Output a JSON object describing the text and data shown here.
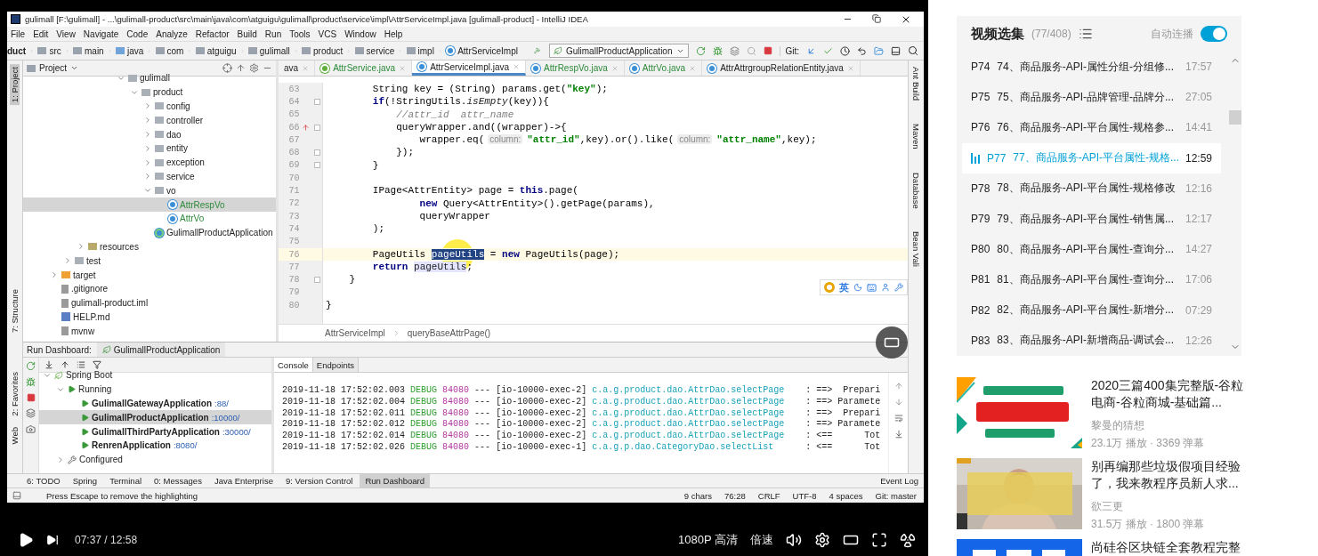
{
  "ide": {
    "window_title": "gulimall [F:\\gulimall] - ...\\gulimall-product\\src\\main\\java\\com\\atguigu\\gulimall\\product\\service\\impl\\AttrServiceImpl.java [gulimall-product] - IntelliJ IDEA",
    "menu": [
      "File",
      "Edit",
      "View",
      "Navigate",
      "Code",
      "Analyze",
      "Refactor",
      "Build",
      "Run",
      "Tools",
      "VCS",
      "Window",
      "Help"
    ],
    "breadcrumbs": [
      {
        "label": "duct",
        "kind": "module"
      },
      {
        "label": "src",
        "kind": "folder"
      },
      {
        "label": "main",
        "kind": "folder"
      },
      {
        "label": "java",
        "kind": "source"
      },
      {
        "label": "com",
        "kind": "folder"
      },
      {
        "label": "atguigu",
        "kind": "folder"
      },
      {
        "label": "gulimall",
        "kind": "folder"
      },
      {
        "label": "product",
        "kind": "folder"
      },
      {
        "label": "service",
        "kind": "folder"
      },
      {
        "label": "impl",
        "kind": "folder"
      },
      {
        "label": "AttrServiceImpl",
        "kind": "class"
      }
    ],
    "run_config": "GulimallProductApplication",
    "vcs_label": "Git:",
    "left_stripe": [
      {
        "label": "1: Project",
        "selected": true
      },
      {
        "label": "7: Structure",
        "selected": false
      },
      {
        "label": "2: Favorites",
        "selected": false
      },
      {
        "label": "Web",
        "selected": false
      }
    ],
    "project": {
      "title": "Project",
      "tree": [
        {
          "children": [
            {
              "children": [
                {
                  "children": [
                    {
                      "children": [
                        {
                          "children": [
                            {
                              "label": "gulimall",
                              "kind": "folder",
                              "expanded": true,
                              "selected": false,
                              "children": [
                                {
                                  "label": "product",
                                  "kind": "folder",
                                  "expanded": true,
                                  "selected": false,
                                  "children": [
                                    {
                                      "label": "config",
                                      "kind": "folder",
                                      "expanded": false,
                                      "selected": false
                                    },
                                    {
                                      "label": "controller",
                                      "kind": "folder",
                                      "expanded": false,
                                      "selected": false
                                    },
                                    {
                                      "label": "dao",
                                      "kind": "folder",
                                      "expanded": false,
                                      "selected": false
                                    },
                                    {
                                      "label": "entity",
                                      "kind": "folder",
                                      "expanded": false,
                                      "selected": false
                                    },
                                    {
                                      "label": "exception",
                                      "kind": "folder",
                                      "expanded": false,
                                      "selected": false
                                    },
                                    {
                                      "label": "service",
                                      "kind": "folder",
                                      "expanded": false,
                                      "selected": false
                                    },
                                    {
                                      "label": "vo",
                                      "kind": "folder",
                                      "expanded": true,
                                      "selected": false,
                                      "children": [
                                        {
                                          "label": "AttrRespVo",
                                          "kind": "added_class",
                                          "selected": true
                                        },
                                        {
                                          "label": "AttrVo",
                                          "kind": "added_class",
                                          "selected": false
                                        }
                                      ]
                                    },
                                    {
                                      "label": "GulimallProductApplication",
                                      "kind": "app",
                                      "selected": false
                                    }
                                  ]
                                }
                              ]
                            }
                          ]
                        }
                      ]
                    }
                  ]
                },
                {
                  "label": "resources",
                  "kind": "resources",
                  "expanded": false,
                  "selected": false
                }
              ]
            },
            {
              "label": "test",
              "kind": "folder",
              "expanded": false,
              "selected": false
            }
          ]
        },
        {
          "label": "target",
          "kind": "excluded",
          "expanded": false,
          "selected": false
        },
        {
          "label": ".gitignore",
          "kind": "file",
          "selected": false
        },
        {
          "label": "gulimall-product.iml",
          "kind": "file",
          "selected": false
        },
        {
          "label": "HELP.md",
          "kind": "markdown",
          "selected": false
        },
        {
          "label": "mvnw",
          "kind": "file",
          "selected": false
        }
      ]
    },
    "editor_tabs": [
      {
        "label": "ava",
        "kind": "partial",
        "added": false,
        "selected": false
      },
      {
        "label": "AttrService.java",
        "kind": "interface",
        "added": true,
        "selected": false
      },
      {
        "label": "AttrServiceImpl.java",
        "kind": "class",
        "added": false,
        "selected": true
      },
      {
        "label": "AttrRespVo.java",
        "kind": "class",
        "added": true,
        "selected": false
      },
      {
        "label": "AttrVo.java",
        "kind": "class",
        "added": true,
        "selected": false
      },
      {
        "label": "AttrAttrgroupRelationEntity.java",
        "kind": "class",
        "added": false,
        "selected": false
      }
    ],
    "code": [
      {
        "number": "63",
        "current": false,
        "fold": false,
        "override": false,
        "tokens": [
          {
            "kind": "plain",
            "text": "        String key = (String) params.get("
          },
          {
            "kind": "string",
            "text": "\"key\""
          },
          {
            "kind": "plain",
            "text": ");"
          }
        ]
      },
      {
        "number": "64",
        "current": false,
        "fold": true,
        "override": false,
        "tokens": [
          {
            "kind": "keyword",
            "text": "        if"
          },
          {
            "kind": "plain",
            "text": "(!StringUtils."
          },
          {
            "kind": "static",
            "text": "isEmpty"
          },
          {
            "kind": "plain",
            "text": "(key)){"
          }
        ]
      },
      {
        "number": "65",
        "current": false,
        "fold": false,
        "override": false,
        "tokens": [
          {
            "kind": "comment",
            "text": "            //attr_id  attr_name"
          }
        ]
      },
      {
        "number": "66",
        "current": false,
        "fold": true,
        "override": true,
        "tokens": [
          {
            "kind": "plain",
            "text": "            queryWrapper.and((wrapper)->{"
          }
        ]
      },
      {
        "number": "67",
        "current": false,
        "fold": false,
        "override": false,
        "tokens": [
          {
            "kind": "plain",
            "text": "                wrapper.eq("
          },
          {
            "kind": "hint",
            "text": "column:"
          },
          {
            "kind": "string",
            "text": "\"attr_id\""
          },
          {
            "kind": "plain",
            "text": ",key).or().like("
          },
          {
            "kind": "hint",
            "text": "column:"
          },
          {
            "kind": "string",
            "text": "\"attr_name\""
          },
          {
            "kind": "plain",
            "text": ",key);"
          }
        ]
      },
      {
        "number": "68",
        "current": false,
        "fold": true,
        "override": false,
        "tokens": [
          {
            "kind": "plain",
            "text": "            });"
          }
        ]
      },
      {
        "number": "69",
        "current": false,
        "fold": true,
        "override": false,
        "tokens": [
          {
            "kind": "plain",
            "text": "        }"
          }
        ]
      },
      {
        "number": "70",
        "current": false,
        "fold": false,
        "override": false
      },
      {
        "number": "71",
        "current": false,
        "fold": false,
        "override": false,
        "tokens": [
          {
            "kind": "plain",
            "text": "        IPage<AttrEntity> page = "
          },
          {
            "kind": "keyword",
            "text": "this"
          },
          {
            "kind": "plain",
            "text": ".page("
          }
        ]
      },
      {
        "number": "72",
        "current": false,
        "fold": false,
        "override": false,
        "tokens": [
          {
            "kind": "keyword",
            "text": "                new"
          },
          {
            "kind": "plain",
            "text": " Query<AttrEntity>().getPage(params),"
          }
        ]
      },
      {
        "number": "73",
        "current": false,
        "fold": false,
        "override": false,
        "tokens": [
          {
            "kind": "plain",
            "text": "                queryWrapper"
          }
        ]
      },
      {
        "number": "74",
        "current": false,
        "fold": false,
        "override": false,
        "tokens": [
          {
            "kind": "plain",
            "text": "        );"
          }
        ]
      },
      {
        "number": "75",
        "current": false,
        "fold": false,
        "override": false
      },
      {
        "number": "76",
        "current": true,
        "fold": false,
        "override": false,
        "tokens": [
          {
            "kind": "plain",
            "text": "        PageUtils "
          },
          {
            "kind": "selected",
            "text": "pageUtils"
          },
          {
            "kind": "plain",
            "text": " = "
          },
          {
            "kind": "keyword",
            "text": "new"
          },
          {
            "kind": "plain",
            "text": " PageUtils(page);"
          }
        ]
      },
      {
        "number": "77",
        "current": false,
        "fold": false,
        "override": false,
        "tokens": [
          {
            "kind": "keyword",
            "text": "        return "
          },
          {
            "kind": "usage",
            "text": "pageUtils"
          },
          {
            "kind": "plain",
            "text": ";"
          }
        ]
      },
      {
        "number": "78",
        "current": false,
        "fold": true,
        "override": false,
        "tokens": [
          {
            "kind": "plain",
            "text": "    }"
          }
        ]
      },
      {
        "number": "79",
        "current": false,
        "fold": false,
        "override": false
      },
      {
        "number": "80",
        "current": false,
        "fold": false,
        "override": false,
        "tokens": [
          {
            "kind": "plain",
            "text": "}"
          }
        ]
      }
    ],
    "editor_breadcrumbs": [
      "AttrServiceImpl",
      "queryBaseAttrPage()"
    ],
    "right_stripe": [
      "Ant Build",
      "Maven",
      "Database",
      "Bean Vali"
    ],
    "ime_toolbar": {
      "label": "英"
    },
    "run_dashboard": {
      "title": "Run Dashboard:",
      "tab": "GulimallProductApplication",
      "tree": [
        {
          "label": "Spring Boot",
          "kind": "group",
          "expanded": true,
          "selected": false,
          "children": [
            {
              "label": "Running",
              "kind": "status",
              "expanded": true,
              "selected": false,
              "children": [
                {
                  "label": "GulimallGatewayApplication",
                  "port": ":88/",
                  "kind": "app",
                  "selected": false
                },
                {
                  "label": "GulimallProductApplication",
                  "port": ":10000/",
                  "kind": "app",
                  "selected": true
                },
                {
                  "label": "GulimallThirdPartyApplication",
                  "port": ":30000/",
                  "kind": "app",
                  "selected": false
                },
                {
                  "label": "RenrenApplication",
                  "port": ":8080/",
                  "kind": "app",
                  "selected": false
                }
              ]
            },
            {
              "label": "Configured",
              "kind": "config",
              "expanded": false,
              "selected": false
            }
          ]
        }
      ]
    },
    "console_tabs": [
      {
        "label": "Console",
        "selected": true
      },
      {
        "label": "Endpoints",
        "selected": false
      }
    ],
    "log": [
      {
        "time": "2019-11-18 17:52:02.003",
        "level": "DEBUG",
        "pid": "84080",
        "sep": "---",
        "thread": "[io-10000-exec-2]",
        "logger": "c.a.g.product.dao.AttrDao.selectPage",
        "message": ": ==>  Prepari"
      },
      {
        "time": "2019-11-18 17:52:02.004",
        "level": "DEBUG",
        "pid": "84080",
        "sep": "---",
        "thread": "[io-10000-exec-2]",
        "logger": "c.a.g.product.dao.AttrDao.selectPage",
        "message": ": ==> Paramete"
      },
      {
        "time": "2019-11-18 17:52:02.011",
        "level": "DEBUG",
        "pid": "84080",
        "sep": "---",
        "thread": "[io-10000-exec-2]",
        "logger": "c.a.g.product.dao.AttrDao.selectPage",
        "message": ": ==>  Prepari"
      },
      {
        "time": "2019-11-18 17:52:02.012",
        "level": "DEBUG",
        "pid": "84080",
        "sep": "---",
        "thread": "[io-10000-exec-2]",
        "logger": "c.a.g.product.dao.AttrDao.selectPage",
        "message": ": ==> Paramete"
      },
      {
        "time": "2019-11-18 17:52:02.014",
        "level": "DEBUG",
        "pid": "84080",
        "sep": "---",
        "thread": "[io-10000-exec-2]",
        "logger": "c.a.g.product.dao.AttrDao.selectPage",
        "message": ": <==      Tot"
      },
      {
        "time": "2019-11-18 17:52:02.026",
        "level": "DEBUG",
        "pid": "84080",
        "sep": "---",
        "thread": "[io-10000-exec-1]",
        "logger": "c.a.g.p.dao.CategoryDao.selectList",
        "message": ": <==      Tot"
      }
    ],
    "tool_windows": [
      {
        "label": "6: TODO",
        "selected": false
      },
      {
        "label": "Spring",
        "selected": false
      },
      {
        "label": "Terminal",
        "selected": false
      },
      {
        "label": "0: Messages",
        "selected": false
      },
      {
        "label": "Java Enterprise",
        "selected": false
      },
      {
        "label": "9: Version Control",
        "selected": false
      },
      {
        "label": "Run Dashboard",
        "selected": true
      },
      {
        "label": "Event Log",
        "selected": false
      }
    ],
    "status": {
      "message": "Press Escape to remove the highlighting",
      "items": [
        "9 chars",
        "76:28",
        "CRLF",
        "UTF-8",
        "4 spaces",
        "Git: master"
      ]
    }
  },
  "player": {
    "current_time": "07:37",
    "separator": "/",
    "duration": "12:58",
    "quality": "1080P 高清",
    "speed": "倍速"
  },
  "playlist": {
    "title": "视频选集",
    "count": "(77/408)",
    "autoplay_label": "自动连播",
    "autoplay_on": true,
    "items": [
      {
        "part": "P74",
        "title": "74、商品服务-API-属性分组-分组修...",
        "duration": "17:57",
        "selected": false
      },
      {
        "part": "P75",
        "title": "75、商品服务-API-品牌管理-品牌分...",
        "duration": "27:05",
        "selected": false
      },
      {
        "part": "P76",
        "title": "76、商品服务-API-平台属性-规格参...",
        "duration": "14:41",
        "selected": false
      },
      {
        "part": "P77",
        "title": "77、商品服务-API-平台属性-规格...",
        "duration": "12:59",
        "selected": true
      },
      {
        "part": "P78",
        "title": "78、商品服务-API-平台属性-规格修改",
        "duration": "12:16",
        "selected": false
      },
      {
        "part": "P79",
        "title": "79、商品服务-API-平台属性-销售属...",
        "duration": "12:17",
        "selected": false
      },
      {
        "part": "P80",
        "title": "80、商品服务-API-平台属性-查询分...",
        "duration": "14:27",
        "selected": false
      },
      {
        "part": "P81",
        "title": "81、商品服务-API-平台属性-查询分...",
        "duration": "17:06",
        "selected": false
      },
      {
        "part": "P82",
        "title": "82、商品服务-API-平台属性-新增分...",
        "duration": "07:29",
        "selected": false
      },
      {
        "part": "P83",
        "title": "83、商品服务-API-新增商品-调试会...",
        "duration": "12:26",
        "selected": false
      }
    ]
  },
  "recommendations": [
    {
      "title": "2020三篇400集完整版-谷粒电商-谷粒商城-基础篇...",
      "author": "黎曼的猜想",
      "stats": "23.1万 播放 · 3369 弹幕",
      "thumbnail": {
        "kind": "poster"
      }
    },
    {
      "title": "别再编那些垃圾假项目经验了，我来教程序员新人求...",
      "author": "欲三更",
      "stats": "31.5万 播放 · 1800 弹幕",
      "thumbnail": {
        "kind": "person"
      }
    },
    {
      "title": "尚硅谷区块链全套教程完整",
      "thumbnail": {
        "kind": "banner"
      }
    }
  ]
}
